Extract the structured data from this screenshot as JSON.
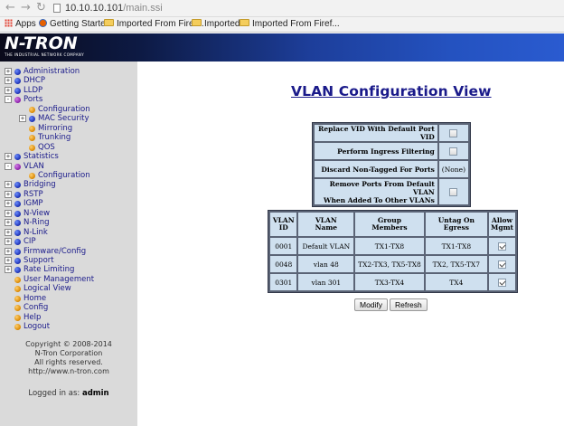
{
  "browser": {
    "url_host": "10.10.10.101",
    "url_path": "/main.ssi",
    "bookmarks": [
      "Apps",
      "Getting Started",
      "Imported From Firef...",
      "Imported",
      "Imported From Firef..."
    ]
  },
  "header": {
    "logo": "N-TRON",
    "tagline": "THE INDUSTRIAL NETWORK COMPANY"
  },
  "sidebar": {
    "items": [
      {
        "label": "Administration",
        "expander": "+"
      },
      {
        "label": "DHCP",
        "expander": "+"
      },
      {
        "label": "LLDP",
        "expander": "+"
      },
      {
        "label": "Ports",
        "expander": "−"
      },
      {
        "label": "Configuration"
      },
      {
        "label": "MAC Security",
        "expander": "+"
      },
      {
        "label": "Mirroring"
      },
      {
        "label": "Trunking"
      },
      {
        "label": "QOS"
      },
      {
        "label": "Statistics",
        "expander": "+"
      },
      {
        "label": "VLAN",
        "expander": "−"
      },
      {
        "label": "Configuration"
      },
      {
        "label": "Bridging",
        "expander": "+"
      },
      {
        "label": "RSTP",
        "expander": "+"
      },
      {
        "label": "IGMP",
        "expander": "+"
      },
      {
        "label": "N-View",
        "expander": "+"
      },
      {
        "label": "N-Ring",
        "expander": "+"
      },
      {
        "label": "N-Link",
        "expander": "+"
      },
      {
        "label": "CIP",
        "expander": "+"
      },
      {
        "label": "Firmware/Config",
        "expander": "+"
      },
      {
        "label": "Support",
        "expander": "+"
      },
      {
        "label": "Rate Limiting",
        "expander": "+"
      },
      {
        "label": "User Management"
      },
      {
        "label": "Logical View"
      },
      {
        "label": "Home"
      },
      {
        "label": "Config"
      },
      {
        "label": "Help"
      },
      {
        "label": "Logout"
      }
    ],
    "copyright_lines": [
      "Copyright © 2008-2014",
      "N-Tron Corporation",
      "All rights reserved.",
      "http://www.n-tron.com"
    ],
    "logged_in_label": "Logged in as:",
    "logged_in_user": "admin"
  },
  "main": {
    "title": "VLAN Configuration View",
    "options": [
      {
        "label": "Replace VID With Default Port VID",
        "value": "",
        "checked": false
      },
      {
        "label": "Perform Ingress Filtering",
        "value": "",
        "checked": false
      },
      {
        "label": "Discard Non-Tagged For Ports",
        "value": "(None)"
      },
      {
        "label_line1": "Remove Ports From Default VLAN",
        "label_line2": "When Added To Other VLANs",
        "value": "",
        "checked": false
      }
    ],
    "vlan_table": {
      "headers": [
        {
          "l1": "VLAN",
          "l2": "ID"
        },
        {
          "l1": "VLAN",
          "l2": "Name"
        },
        {
          "l1": "Group",
          "l2": "Members"
        },
        {
          "l1": "Untag On",
          "l2": "Egress"
        },
        {
          "l1": "Allow",
          "l2": "Mgmt"
        }
      ],
      "rows": [
        {
          "id": "0001",
          "name": "Default VLAN",
          "members": "TX1-TX8",
          "untag": "TX1-TX8",
          "mgmt": true
        },
        {
          "id": "0048",
          "name": "vlan 48",
          "members": "TX2-TX3, TX5-TX8",
          "untag": "TX2, TX5-TX7",
          "mgmt": true
        },
        {
          "id": "0301",
          "name": "vlan 301",
          "members": "TX3-TX4",
          "untag": "TX4",
          "mgmt": true
        }
      ]
    },
    "buttons": {
      "modify": "Modify",
      "refresh": "Refresh"
    }
  }
}
